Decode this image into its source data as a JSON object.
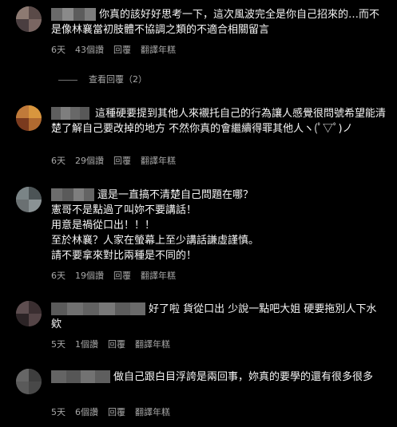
{
  "colors": {
    "background": "#000000",
    "text": "#f5f5f5",
    "meta": "#a8a8a8"
  },
  "comments": [
    {
      "text": "你真的該好好思考一下，這次風波完全是你自己招來的…而不是像林襄當初肢體不協調之類的不適合相關留言",
      "age": "6天",
      "likes": "43個讚",
      "reply": "回覆",
      "translate": "翻譯年糕"
    },
    {
      "text": "這種硬要提到其他人來襯托自己的行為讓人感覺很問號希望能清楚了解自己要改掉的地方 不然你真的會繼續得罪其他人ヽ(ﾟ▽ﾟ)ノ",
      "age": "6天",
      "likes": "29個讚",
      "reply": "回覆",
      "translate": "翻譯年糕"
    },
    {
      "text": "還是一直搞不清楚自己問題在哪？\n憲哥不是點過了叫妳不要講話！\n用意是禍從口出！！！\n至於林襄？人家在螢幕上至少講話謙虛謹慎。\n請不要拿來對比兩種是不同的！",
      "age": "6天",
      "likes": "19個讚",
      "reply": "回覆",
      "translate": "翻譯年糕"
    },
    {
      "text": "好了啦 貨從口出 少說一點吧大姐 硬要拖別人下水欸",
      "age": "5天",
      "likes": "1個讚",
      "reply": "回覆",
      "translate": "翻譯年糕"
    },
    {
      "text": "做自己跟白目浮誇是兩回事，妳真的要學的還有很多很多",
      "age": "5天",
      "likes": "6個讚",
      "reply": "回覆",
      "translate": "翻譯年糕"
    }
  ],
  "view_replies": "查看回覆（2）"
}
